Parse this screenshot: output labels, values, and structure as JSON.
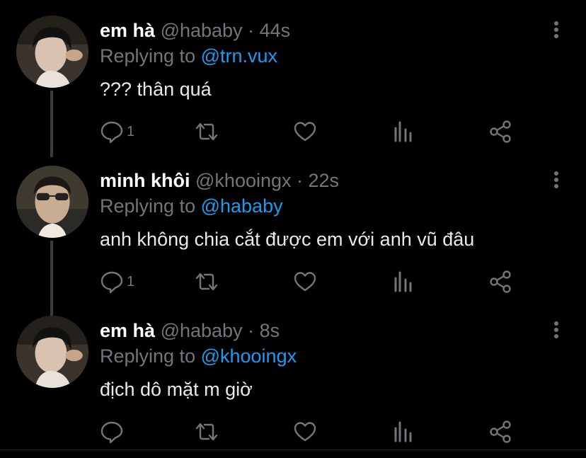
{
  "tweets": [
    {
      "display_name": "em hà",
      "handle": "@hababy",
      "time": "44s",
      "replying_prefix": "Replying to ",
      "replying_to": "@trn.vux",
      "text": "??? thân quá",
      "reply_count": "1"
    },
    {
      "display_name": "minh khôi",
      "handle": "@khooingx",
      "time": "22s",
      "replying_prefix": "Replying to ",
      "replying_to": "@hababy",
      "text": "anh không chia cắt được em với anh vũ đâu",
      "reply_count": "1"
    },
    {
      "display_name": "em hà",
      "handle": "@hababy",
      "time": "8s",
      "replying_prefix": "Replying to ",
      "replying_to": "@khooingx",
      "text": "địch dô mặt m giờ",
      "reply_count": ""
    }
  ],
  "separator": " · ",
  "colors": {
    "background": "#000000",
    "text": "#e7e9ea",
    "muted": "#71767b",
    "mention": "#1d9bf0",
    "thread_line": "#3a3d40"
  },
  "icons": [
    "more-vert-icon",
    "reply-icon",
    "retweet-icon",
    "like-icon",
    "analytics-icon",
    "share-icon"
  ]
}
